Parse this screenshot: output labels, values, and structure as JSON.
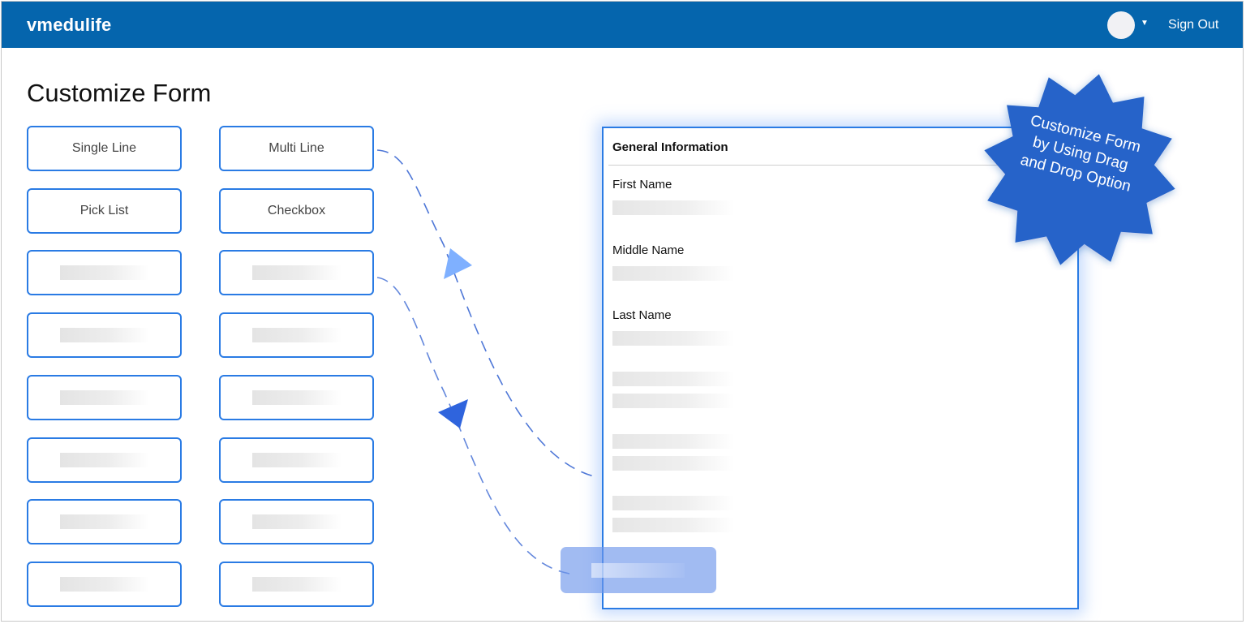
{
  "header": {
    "brand": "vmedulife",
    "sign_out_label": "Sign Out"
  },
  "page": {
    "title": "Customize Form"
  },
  "palette": {
    "items": [
      {
        "label": "Single Line"
      },
      {
        "label": "Multi Line"
      },
      {
        "label": "Pick List"
      },
      {
        "label": "Checkbox"
      },
      {
        "label": ""
      },
      {
        "label": ""
      },
      {
        "label": ""
      },
      {
        "label": ""
      },
      {
        "label": ""
      },
      {
        "label": ""
      },
      {
        "label": ""
      },
      {
        "label": ""
      },
      {
        "label": ""
      },
      {
        "label": ""
      },
      {
        "label": ""
      },
      {
        "label": ""
      }
    ]
  },
  "form": {
    "section_title": "General Information",
    "fields": [
      {
        "label": "First Name"
      },
      {
        "label": "Middle Name"
      },
      {
        "label": "Last Name"
      }
    ]
  },
  "badge": {
    "line1": "Customize Form",
    "line2": "by Using Drag",
    "line3": "and Drop Option",
    "color": "#2563c9"
  },
  "colors": {
    "header_bg": "#0565ad",
    "accent_border": "#2a7be4",
    "drag_ghost": "#6e96eb"
  },
  "icons": {
    "avatar": "user-avatar-icon",
    "dropdown": "chevron-down-icon"
  }
}
